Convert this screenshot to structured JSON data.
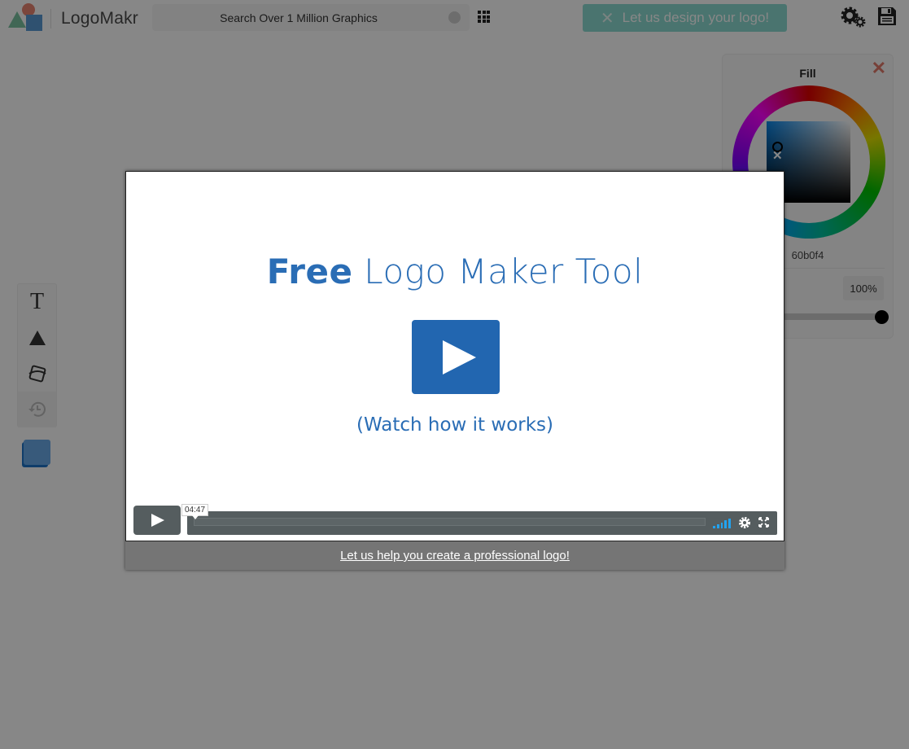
{
  "header": {
    "brand": "LogoMakr",
    "search": {
      "placeholder": "Search Over 1 Million Graphics",
      "value": ""
    },
    "design_button_label": "Let us design your logo!"
  },
  "color_panel": {
    "title": "Fill",
    "close_glyph": "✕",
    "hex_value": "60b0f4",
    "opacity_label": "100%",
    "opacity_fraction": 1.0,
    "accent_color": "#60b0f4",
    "picker_marker_glyph": "✕"
  },
  "toolbar": {
    "items": [
      {
        "name": "text-tool",
        "glyph": "T"
      },
      {
        "name": "shape-tool",
        "glyph": "▲"
      },
      {
        "name": "background-tool",
        "glyph": ""
      },
      {
        "name": "history-tool",
        "glyph": ""
      }
    ]
  },
  "modal": {
    "video": {
      "title_bold": "Free",
      "title_rest": " Logo Maker Tool",
      "subtitle": "(Watch how it works)",
      "duration": "04:47",
      "progress_fraction": 0.0,
      "volume_bars": 5
    },
    "footer_link": "Let us help you create a professional logo!"
  }
}
